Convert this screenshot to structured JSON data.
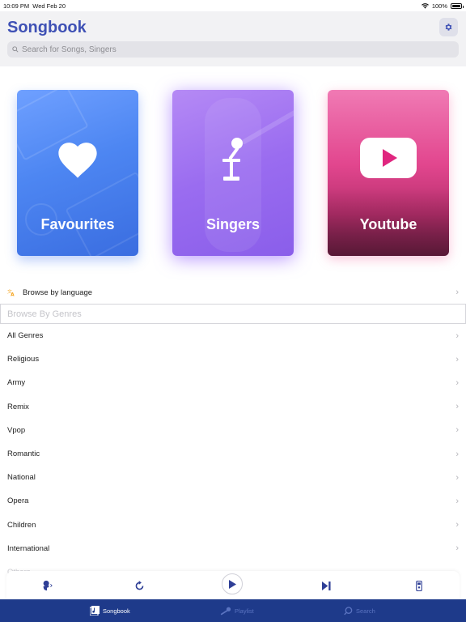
{
  "status_bar": {
    "time": "10:09 PM",
    "date": "Wed Feb 20",
    "battery": "100%"
  },
  "header": {
    "title": "Songbook",
    "settings_icon": "gear-icon",
    "search_placeholder": "Search for Songs, Singers"
  },
  "cards": [
    {
      "label": "Favourites",
      "icon": "heart-icon"
    },
    {
      "label": "Singers",
      "icon": "microphone-icon"
    },
    {
      "label": "Youtube",
      "icon": "youtube-play-icon"
    }
  ],
  "browse_language": {
    "label": "Browse by language",
    "icon": "translate-icon"
  },
  "genres": {
    "header": "Browse By Genres",
    "items": [
      "All Genres",
      "Religious",
      "Army",
      "Remix",
      "Vpop",
      "Romantic",
      "National",
      "Opera",
      "Children",
      "International",
      "Others"
    ]
  },
  "player": {
    "icons": [
      "vocal-icon",
      "repeat-icon",
      "play-icon",
      "skip-forward-icon",
      "remote-icon"
    ]
  },
  "tabs": [
    {
      "label": "Songbook",
      "icon": "songbook-icon",
      "active": true
    },
    {
      "label": "Playlist",
      "icon": "microphone-icon",
      "active": false
    },
    {
      "label": "Search",
      "icon": "search-icon",
      "active": false
    }
  ],
  "colors": {
    "accent": "#3f51b5",
    "tabbar": "#1e3a8a",
    "favourites": "#4d86f2",
    "singers": "#9a6cf0",
    "youtube": "#e2468e"
  }
}
